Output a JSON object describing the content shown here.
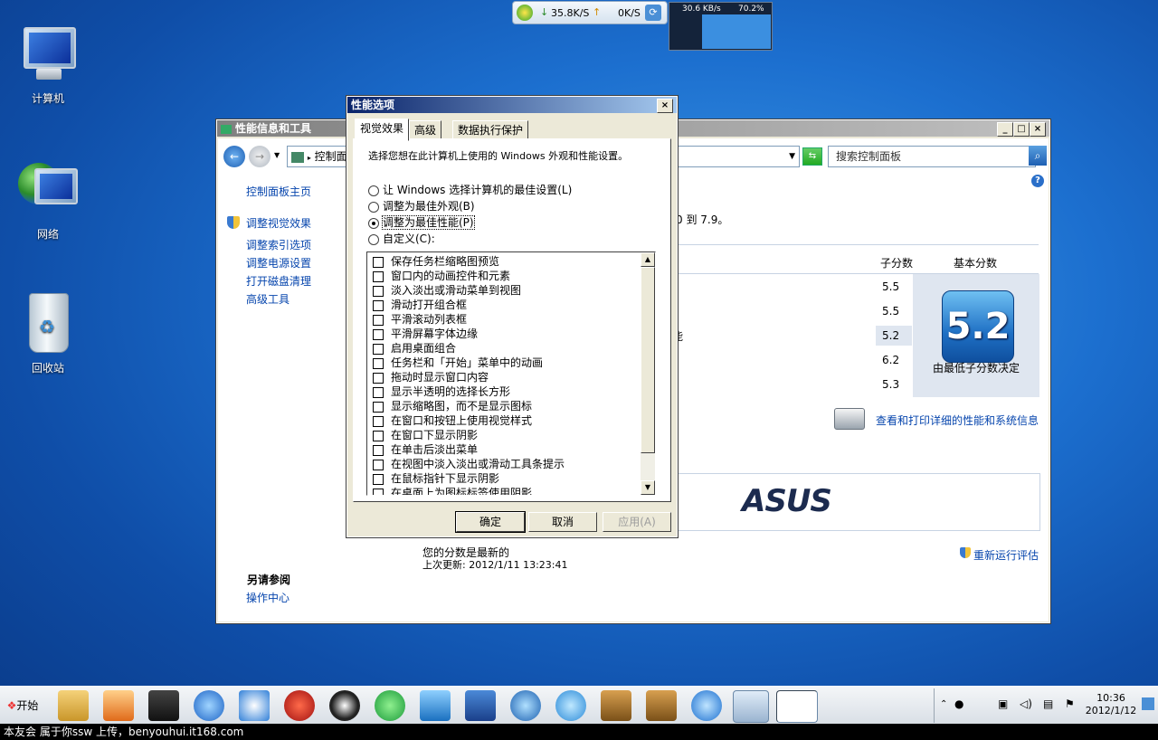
{
  "desktop": {
    "icons": [
      {
        "label": "计算机"
      },
      {
        "label": "网络"
      },
      {
        "label": "回收站"
      }
    ]
  },
  "netmonitor": {
    "download": "35.8K/S",
    "upload": "0K/S",
    "graph_speed": "30.6 KB/s",
    "graph_percent": "70.2%"
  },
  "control_panel": {
    "title": "性能信息和工具",
    "address": "控制面",
    "search_placeholder": "搜索控制面板",
    "sidebar": {
      "home": "控制面板主页",
      "links": [
        "调整视觉效果",
        "调整索引选项",
        "调整电源设置",
        "打开磁盘清理",
        "高级工具"
      ],
      "see_also": "另请参阅",
      "action_center": "操作中心"
    },
    "range_text": "0 到 7.9。",
    "col_subscore": "子分数",
    "col_basescore": "基本分数",
    "subscores": [
      "5.5",
      "5.5",
      "5.2",
      "6.2",
      "5.3"
    ],
    "base_score": "5.2",
    "base_caption": "由最低子分数决定",
    "partial_text": "能",
    "print_link": "查看和打印详细的性能和系统信息",
    "status": "您的分数是最新的",
    "last_update": "上次更新: 2012/1/11 13:23:41",
    "rerun": "重新运行评估",
    "oem_logo": "ASUS"
  },
  "perf_options": {
    "title": "性能选项",
    "tabs": [
      "视觉效果",
      "高级",
      "数据执行保护"
    ],
    "description": "选择您想在此计算机上使用的 Windows 外观和性能设置。",
    "radios": [
      {
        "label": "让 Windows 选择计算机的最佳设置(L)",
        "checked": false
      },
      {
        "label": "调整为最佳外观(B)",
        "checked": false
      },
      {
        "label": "调整为最佳性能(P)",
        "checked": true
      },
      {
        "label": "自定义(C):",
        "checked": false
      }
    ],
    "checklist": [
      "保存任务栏缩略图预览",
      "窗口内的动画控件和元素",
      "淡入淡出或滑动菜单到视图",
      "滑动打开组合框",
      "平滑滚动列表框",
      "平滑屏幕字体边缘",
      "启用桌面组合",
      "任务栏和「开始」菜单中的动画",
      "拖动时显示窗口内容",
      "显示半透明的选择长方形",
      "显示缩略图，而不是显示图标",
      "在窗口和按钮上使用视觉样式",
      "在窗口下显示阴影",
      "在单击后淡出菜单",
      "在视图中淡入淡出或滑动工具条提示",
      "在鼠标指针下显示阴影",
      "在桌面上为图标标签使用阴影"
    ],
    "buttons": {
      "ok": "确定",
      "cancel": "取消",
      "apply": "应用(A)"
    }
  },
  "taskbar": {
    "start": "开始",
    "clock_time": "10:36",
    "clock_date": "2012/1/12"
  },
  "footer": "本友会 属于你ssw 上传，benyouhui.it168.com"
}
